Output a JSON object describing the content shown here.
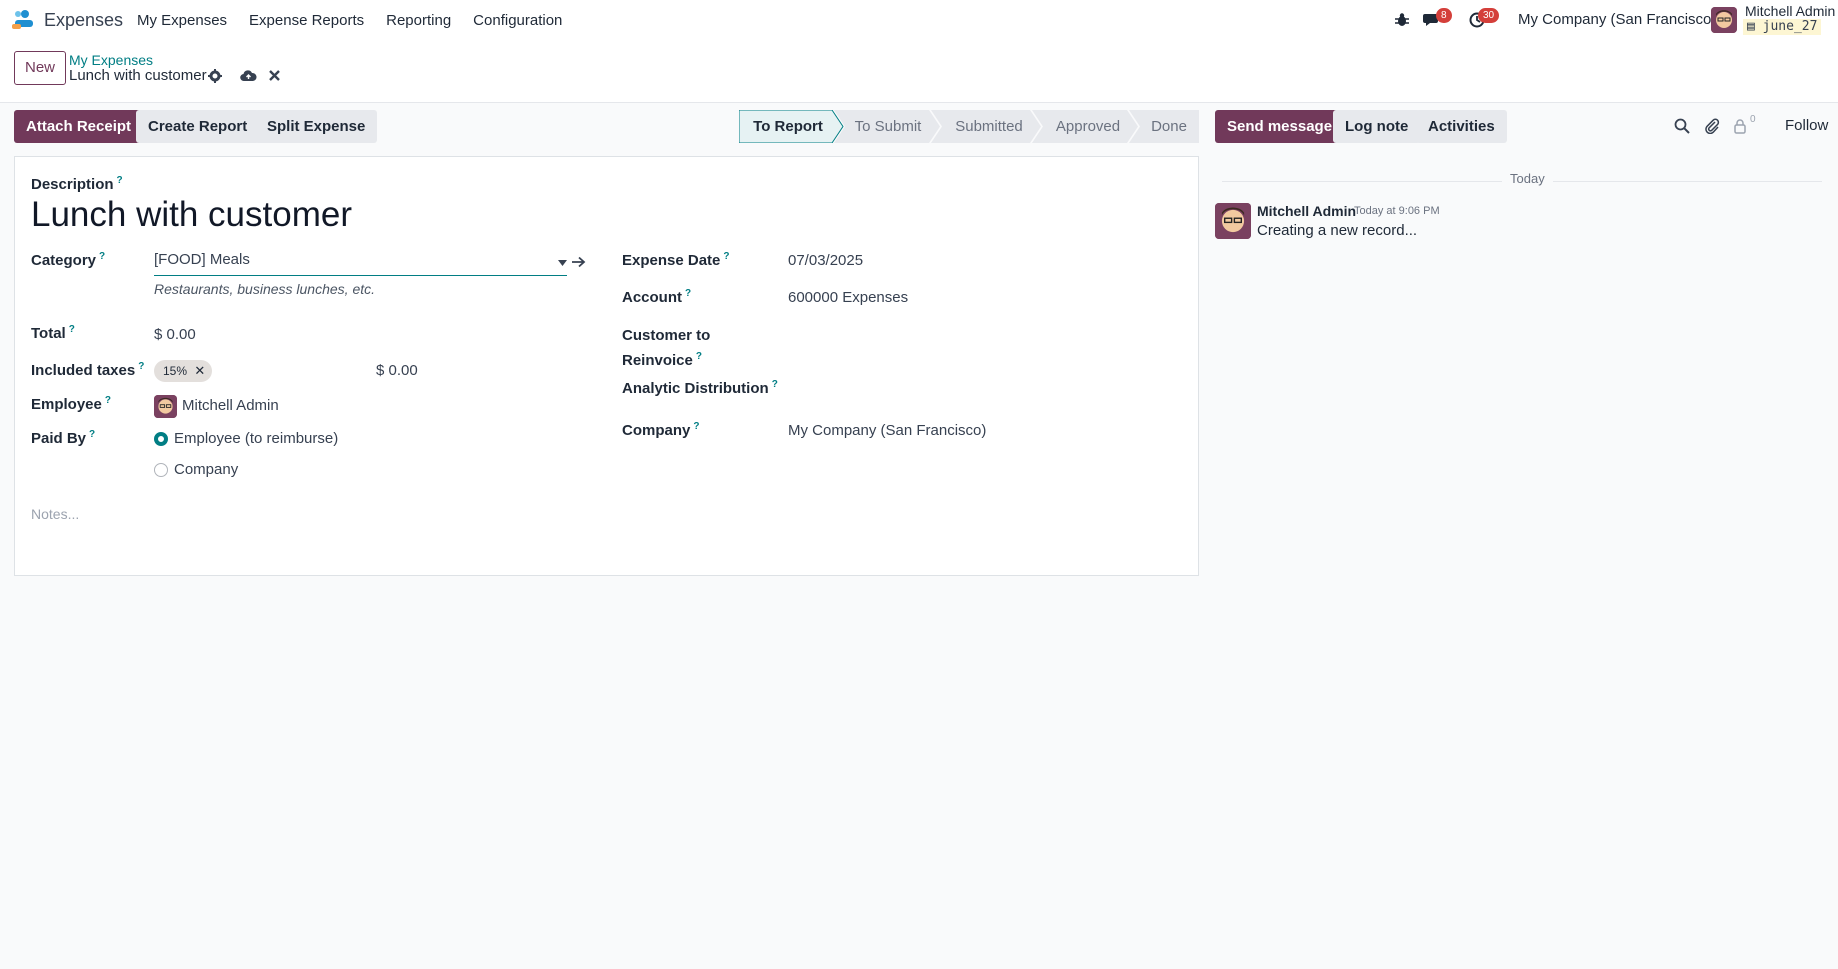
{
  "navbar": {
    "app_name": "Expenses",
    "menu": [
      "My Expenses",
      "Expense Reports",
      "Reporting",
      "Configuration"
    ],
    "messages_badge": "8",
    "activities_badge": "30",
    "company": "My Company (San Francisco)",
    "user_name": "Mitchell Admin",
    "database": "june_27"
  },
  "control_panel": {
    "new_label": "New",
    "breadcrumb": "My Expenses",
    "record_title": "Lunch with customer"
  },
  "actions": {
    "attach_receipt": "Attach Receipt",
    "create_report": "Create Report",
    "split_expense": "Split Expense"
  },
  "statusbar": {
    "stages": [
      "To Report",
      "To Submit",
      "Submitted",
      "Approved",
      "Done"
    ],
    "active": "To Report"
  },
  "form": {
    "description_label": "Description",
    "description": "Lunch with customer",
    "category_label": "Category",
    "category": "[FOOD] Meals",
    "category_desc": "Restaurants, business lunches, etc.",
    "total_label": "Total",
    "total": "$ 0.00",
    "taxes_label": "Included taxes",
    "tax_tag": "15%",
    "tax_amount": "$ 0.00",
    "employee_label": "Employee",
    "employee": "Mitchell Admin",
    "paid_by_label": "Paid By",
    "paid_by_options": [
      "Employee (to reimburse)",
      "Company"
    ],
    "expense_date_label": "Expense Date",
    "expense_date": "07/03/2025",
    "account_label": "Account",
    "account": "600000 Expenses",
    "customer_reinvoice_label_1": "Customer to",
    "customer_reinvoice_label_2": "Reinvoice",
    "analytic_label": "Analytic Distribution",
    "company_label": "Company",
    "company": "My Company (San Francisco)",
    "notes_placeholder": "Notes..."
  },
  "chatter": {
    "send_message": "Send message",
    "log_note": "Log note",
    "activities": "Activities",
    "followers_count": "0",
    "follow": "Follow",
    "date_separator": "Today",
    "messages": [
      {
        "author": "Mitchell Admin",
        "time": "Today at 9:06 PM",
        "body": "Creating a new record..."
      }
    ]
  },
  "colors": {
    "primary": "#71395a",
    "accent": "#017e84",
    "badge": "#d43f3a"
  },
  "icons": [
    "expenses-app-icon",
    "bug-icon",
    "chat-icon",
    "clock-icon",
    "gear-icon",
    "cloud-upload-icon",
    "close-icon",
    "arrow-right-icon",
    "search-icon",
    "paperclip-icon",
    "user-lock-icon"
  ]
}
